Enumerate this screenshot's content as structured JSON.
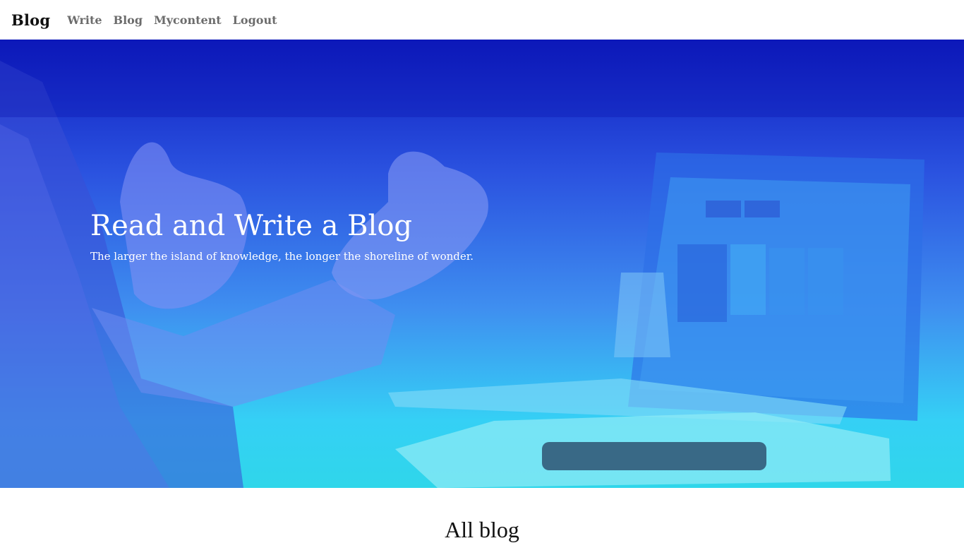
{
  "navbar": {
    "brand": "Blog",
    "links": [
      {
        "label": "Write"
      },
      {
        "label": "Blog"
      },
      {
        "label": "Mycontent"
      },
      {
        "label": "Logout"
      }
    ]
  },
  "hero": {
    "title": "Read and Write a Blog",
    "subtitle": "The larger the island of knowledge, the longer the shoreline of wonder."
  },
  "main": {
    "section_heading": "All blog"
  },
  "colors": {
    "hero_gradient_top": "#0d1bbf",
    "hero_gradient_bottom": "#2fd6ea",
    "nav_link": "#6c6c6c",
    "brand_text": "#111111"
  }
}
